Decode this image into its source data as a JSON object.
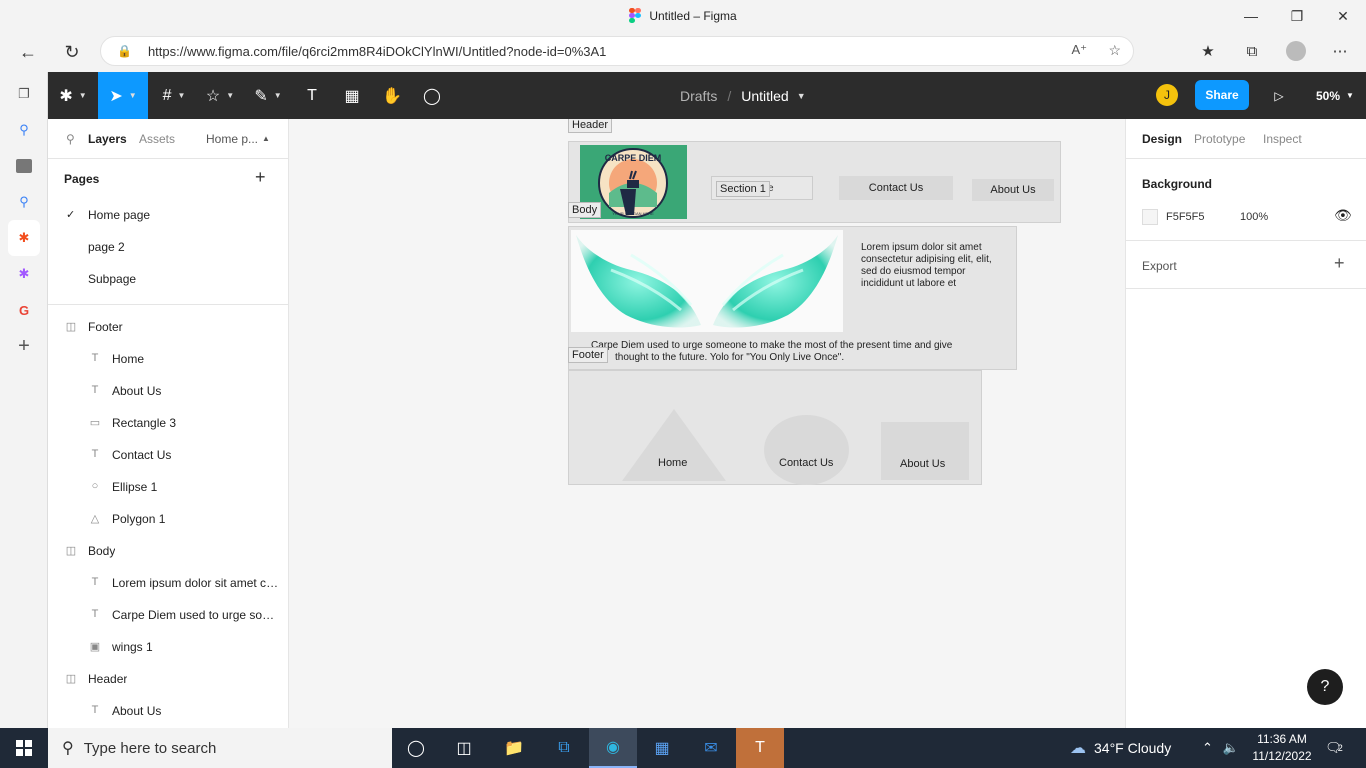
{
  "browser": {
    "window_title": "Untitled – Figma",
    "url": "https://www.figma.com/file/q6rci2mm8R4iDOkClYlnWI/Untitled?node-id=0%3A1"
  },
  "toolbar": {
    "crumb_drafts": "Drafts",
    "crumb_sep": "/",
    "file_name": "Untitled",
    "avatar_initial": "J",
    "share_label": "Share",
    "zoom": "50%"
  },
  "left_panel": {
    "tabs": [
      "Layers",
      "Assets",
      "Home p..."
    ],
    "pages_label": "Pages",
    "pages": [
      "Home page",
      "page 2",
      "Subpage"
    ],
    "layers": [
      {
        "label": "Footer",
        "kind": "frame"
      },
      {
        "label": "Home",
        "kind": "text"
      },
      {
        "label": "About Us",
        "kind": "text"
      },
      {
        "label": "Rectangle 3",
        "kind": "rect"
      },
      {
        "label": "Contact Us",
        "kind": "text"
      },
      {
        "label": "Ellipse 1",
        "kind": "ellipse"
      },
      {
        "label": "Polygon 1",
        "kind": "polygon"
      },
      {
        "label": "Body",
        "kind": "frame"
      },
      {
        "label": "Lorem ipsum dolor sit amet co...",
        "kind": "text"
      },
      {
        "label": "Carpe Diem used to urge som...",
        "kind": "text"
      },
      {
        "label": "wings 1",
        "kind": "image"
      },
      {
        "label": "Header",
        "kind": "frame"
      },
      {
        "label": "About Us",
        "kind": "text"
      }
    ]
  },
  "right_panel": {
    "tabs": [
      "Design",
      "Prototype",
      "Inspect"
    ],
    "background_label": "Background",
    "background_hex": "F5F5F5",
    "background_opacity": "100%",
    "export_label": "Export",
    "help": "?"
  },
  "canvas": {
    "header_label": "Header",
    "body_label": "Body",
    "footer_label": "Footer",
    "logo_title": "CARPE DIEM",
    "logo_slogan": "YOUR SLOGAN HERE",
    "section_label": "Section 1",
    "section_hidden_text": "e",
    "header_contact": "Contact Us",
    "header_about": "About Us",
    "lorem": "Lorem ipsum dolor sit amet consectetur adipising elit, elit, sed do eiusmod tempor incididunt ut labore et",
    "carpe_line1": "Carpe Diem used to urge someone to make the most of the present time and give",
    "carpe_line2": "thought to the future. Yolo for \"You Only Live Once\".",
    "footer_home": "Home",
    "footer_contact": "Contact Us",
    "footer_about": "About Us"
  },
  "taskbar": {
    "search_placeholder": "Type here to search",
    "weather": "34°F  Cloudy",
    "time": "11:36 AM",
    "date": "11/12/2022",
    "notif_count": "2"
  },
  "colors": {
    "figma_blue": "#0d99ff",
    "toolbar_dark": "#2c2c2c",
    "canvas_bg": "#F5F5F5",
    "frame_fill": "#e5e5e5",
    "wings_teal": "#3fe0c0"
  }
}
